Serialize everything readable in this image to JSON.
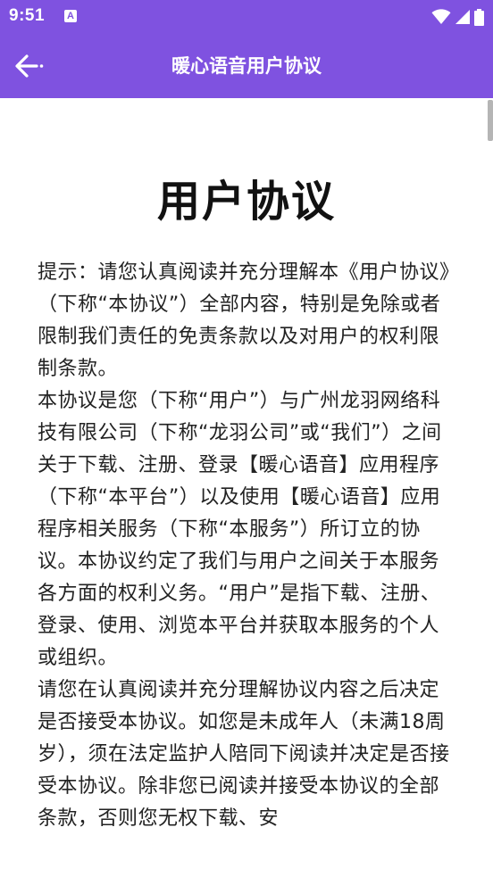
{
  "status_bar": {
    "time": "9:51",
    "notification_letter": "A",
    "icons": [
      "wifi-icon",
      "cellular-signal-icon",
      "battery-icon"
    ]
  },
  "app_bar": {
    "title": "暖心语音用户协议",
    "back_icon": "arrow-back-icon"
  },
  "document": {
    "title": "用户协议",
    "paragraphs": [
      "提示：请您认真阅读并充分理解本《用户协议》（下称“本协议”）全部内容，特别是免除或者限制我们责任的免责条款以及对用户的权利限制条款。",
      "本协议是您（下称“用户”）与广州龙羽网络科技有限公司（下称“龙羽公司”或“我们”）之间关于下载、注册、登录【暖心语音】应用程序（下称“本平台”）以及使用【暖心语音】应用程序相关服务（下称“本服务”）所订立的协议。本协议约定了我们与用户之间关于本服务各方面的权利义务。“用户”是指下载、注册、登录、使用、浏览本平台并获取本服务的个人或组织。",
      "请您在认真阅读并充分理解协议内容之后决定是否接受本协议。如您是未成年人（未满18周岁），须在法定监护人陪同下阅读并决定是否接受本协议。除非您已阅读并接受本协议的全部条款，否则您无权下载、安"
    ]
  },
  "colors": {
    "primary": "#7f52e0",
    "on_primary": "#ffffff",
    "text": "#222222",
    "background": "#ffffff"
  }
}
